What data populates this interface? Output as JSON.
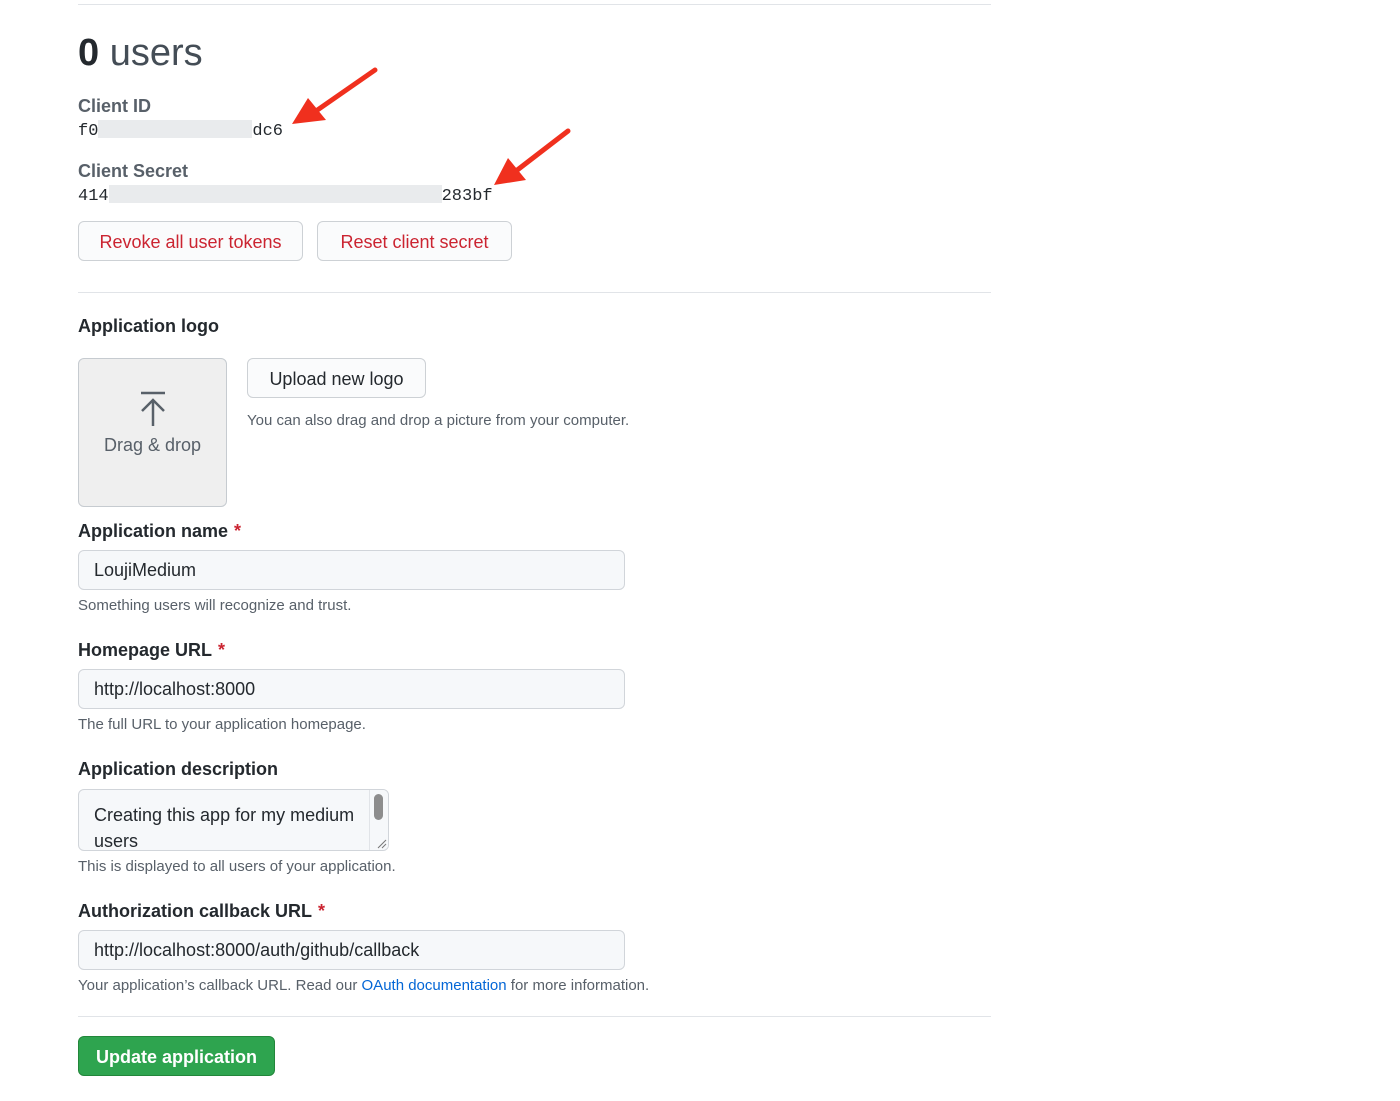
{
  "users": {
    "count": "0",
    "label": "users"
  },
  "client_id": {
    "label": "Client ID",
    "prefix": "f0",
    "suffix": "dc6"
  },
  "client_secret": {
    "label": "Client Secret",
    "prefix": "414",
    "suffix": "283bf"
  },
  "buttons": {
    "revoke": "Revoke all user tokens",
    "reset": "Reset client secret",
    "upload_logo": "Upload new logo",
    "update": "Update application"
  },
  "logo": {
    "title": "Application logo",
    "dropzone": "Drag & drop",
    "hint": "You can also drag and drop a picture from your computer."
  },
  "form": {
    "app_name": {
      "label": "Application name",
      "required": "*",
      "value": "LoujiMedium",
      "note": "Something users will recognize and trust."
    },
    "homepage": {
      "label": "Homepage URL",
      "required": "*",
      "value": "http://localhost:8000",
      "note": "The full URL to your application homepage."
    },
    "description": {
      "label": "Application description",
      "value": "Creating this app for my medium users",
      "note": "This is displayed to all users of your application."
    },
    "callback": {
      "label": "Authorization callback URL",
      "required": "*",
      "value": "http://localhost:8000/auth/github/callback",
      "note_before": "Your application’s callback URL. Read our",
      "note_link": "OAuth documentation",
      "note_after": "for more information."
    }
  },
  "colors": {
    "danger": "#cb2431",
    "primary": "#2ea44f",
    "link": "#0366d6",
    "annotation_arrow": "#f0301e"
  },
  "icons": {
    "upload": "upload-arrow-icon",
    "annotation": "red-arrow-icon"
  }
}
